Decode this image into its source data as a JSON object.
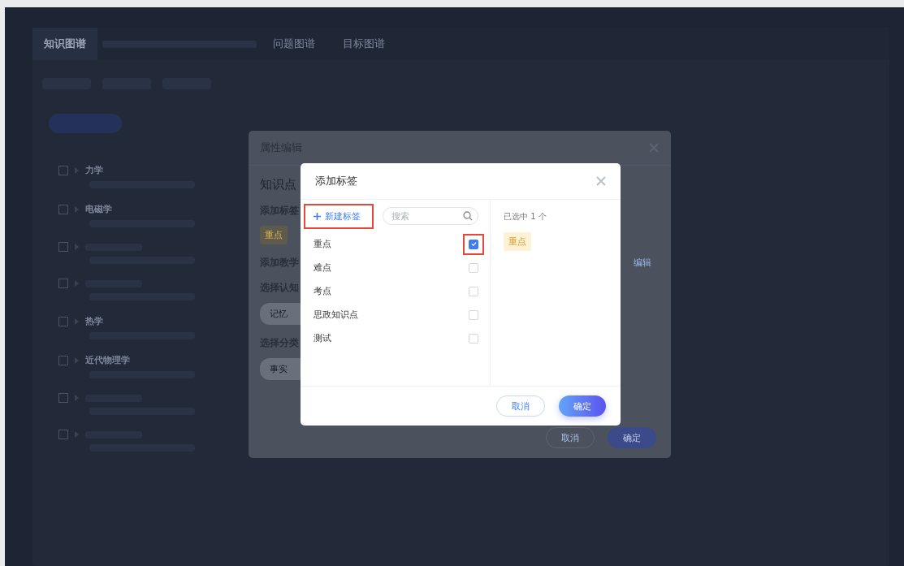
{
  "background": {
    "tabs": [
      {
        "label": "知识图谱",
        "selected": true
      },
      {
        "label": "问题图谱",
        "selected": false
      },
      {
        "label": "目标图谱",
        "selected": false
      }
    ],
    "tree": [
      {
        "kind": "titled",
        "title": "力学",
        "checked": false
      },
      {
        "kind": "titled",
        "title": "电磁学",
        "checked": false
      },
      {
        "kind": "blurred",
        "checked": false
      },
      {
        "kind": "blurred",
        "checked": false
      },
      {
        "kind": "titled",
        "title": "热学",
        "checked": false
      },
      {
        "kind": "titled",
        "title": "近代物理学",
        "checked": false
      },
      {
        "kind": "blurred",
        "checked": false
      },
      {
        "kind": "blurred",
        "checked": false
      }
    ]
  },
  "edit_dialog": {
    "title": "属性编辑",
    "field_label": "知识点",
    "sections": [
      {
        "kind": "tags",
        "label": "添加标签",
        "items": [
          "重点"
        ]
      },
      {
        "kind": "action",
        "label": "添加教学",
        "action": "编辑"
      },
      {
        "kind": "options",
        "label": "选择认知",
        "items": [
          "记忆"
        ]
      },
      {
        "kind": "options",
        "label": "选择分类",
        "items": [
          "事实"
        ]
      }
    ],
    "cancel": "取消",
    "confirm": "确定"
  },
  "tag_dialog": {
    "title": "添加标签",
    "new_tag": {
      "label": "新建标签",
      "highlighted": true
    },
    "search": {
      "placeholder": "搜索"
    },
    "tags": [
      {
        "label": "重点",
        "checked": true,
        "highlighted": true
      },
      {
        "label": "难点",
        "checked": false,
        "highlighted": false
      },
      {
        "label": "考点",
        "checked": false,
        "highlighted": false
      },
      {
        "label": "思政知识点",
        "checked": false,
        "highlighted": false
      },
      {
        "label": "测试",
        "checked": false,
        "highlighted": false
      }
    ],
    "selected_count": "已选中 1 个",
    "selected_tags": [
      {
        "label": "重点"
      }
    ],
    "cancel": "取消",
    "confirm": "确定"
  }
}
